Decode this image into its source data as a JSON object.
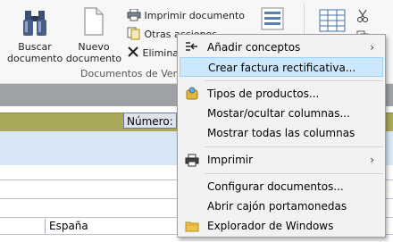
{
  "ribbon": {
    "buscar_label": "Buscar documento",
    "nuevo_label": "Nuevo documento",
    "imprimir_label": "Imprimir documento",
    "otras_label": "Otras acciones",
    "eliminar_label": "Elimina",
    "group_label": "Documentos de Ven"
  },
  "form": {
    "numero_label": "Número:",
    "pais_value": "España"
  },
  "menu": {
    "items": [
      {
        "label": "Añadir conceptos",
        "icon": "add-concepts-icon",
        "submenu": true
      },
      {
        "label": "Crear factura rectificativa...",
        "highlighted": true
      },
      {
        "label": "Tipos de productos...",
        "icon": "product-types-icon"
      },
      {
        "label": "Mostar/ocultar columnas..."
      },
      {
        "label": "Mostrar todas las columnas"
      },
      {
        "label": "Imprimir",
        "icon": "printer-icon",
        "submenu": true
      },
      {
        "label": "Configurar documentos..."
      },
      {
        "label": "Abrir cajón portamonedas"
      },
      {
        "label": "Explorador de Windows",
        "icon": "folder-icon"
      }
    ],
    "submenu_arrow": "›"
  },
  "colors": {
    "menu_highlight": "#cce8ff",
    "olive_band": "#a9a957",
    "gray_band": "#9ea2a6"
  }
}
